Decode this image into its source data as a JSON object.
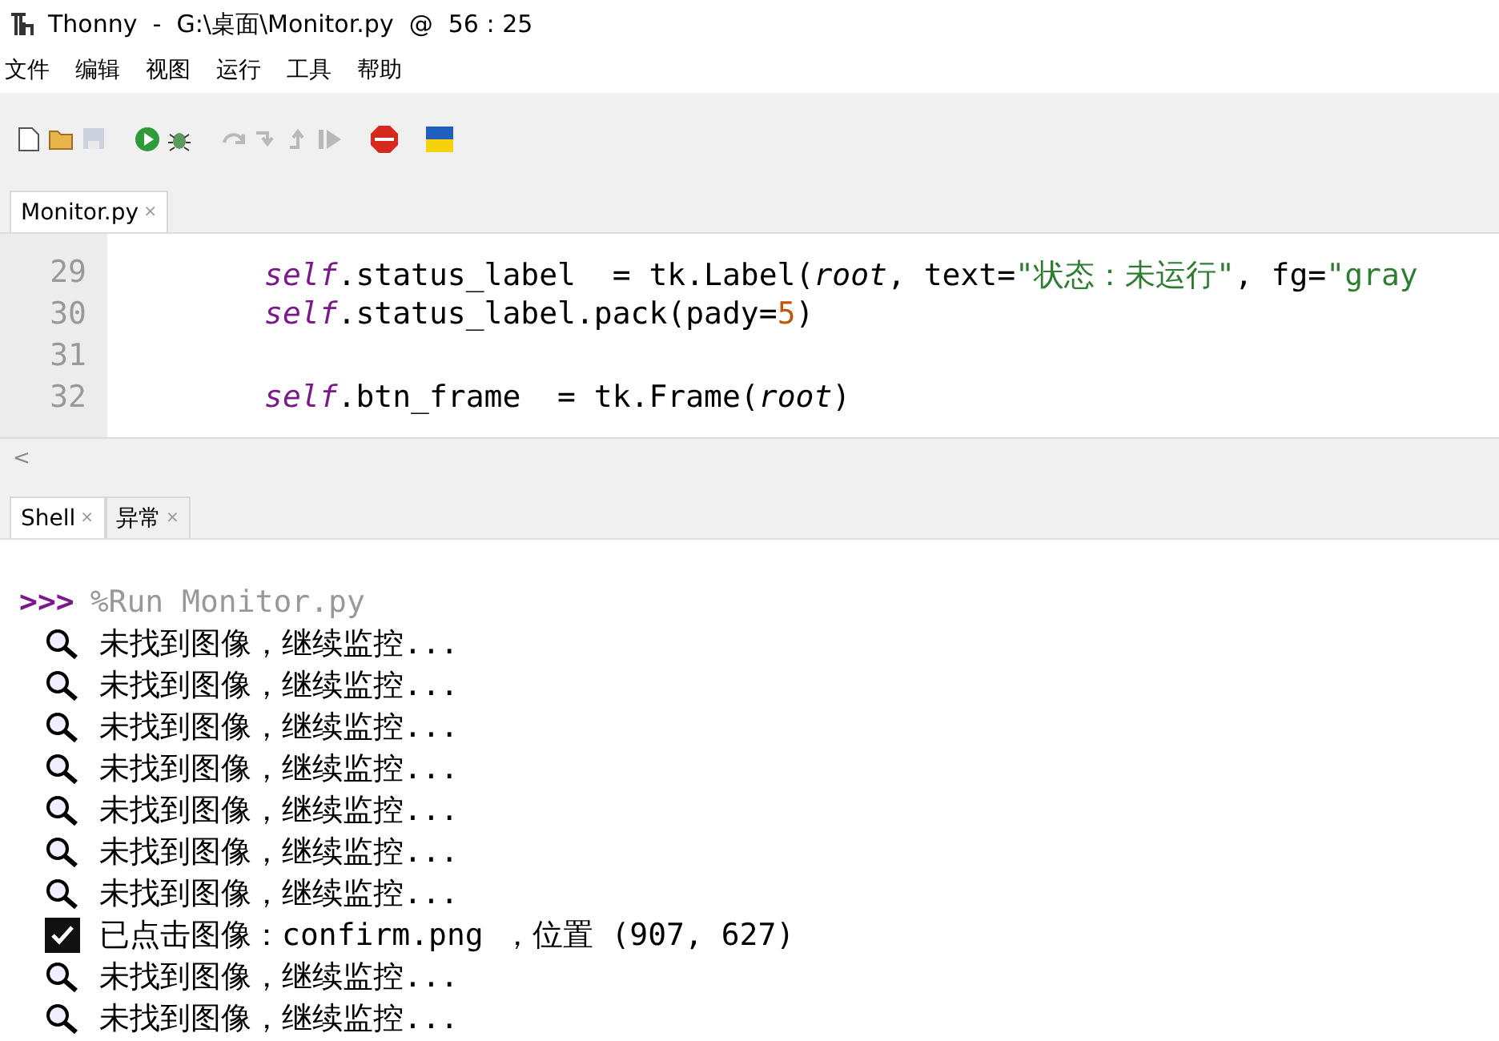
{
  "window": {
    "title": "Thonny  -  G:\\桌面\\Monitor.py  @  56 : 25"
  },
  "menu": [
    "文件",
    "编辑",
    "视图",
    "运行",
    "工具",
    "帮助"
  ],
  "toolbar": [
    {
      "kind": "new",
      "disabled": false
    },
    {
      "kind": "open",
      "disabled": false
    },
    {
      "kind": "save",
      "disabled": true
    },
    {
      "kind": "gap"
    },
    {
      "kind": "run",
      "disabled": false
    },
    {
      "kind": "debug",
      "disabled": false
    },
    {
      "kind": "gap"
    },
    {
      "kind": "step-over",
      "disabled": true
    },
    {
      "kind": "step-into",
      "disabled": true
    },
    {
      "kind": "step-out",
      "disabled": true
    },
    {
      "kind": "resume",
      "disabled": true
    },
    {
      "kind": "gap"
    },
    {
      "kind": "stop",
      "disabled": false
    },
    {
      "kind": "gap"
    },
    {
      "kind": "flag",
      "disabled": false
    }
  ],
  "editor_tabs": [
    {
      "label": "Monitor.py",
      "close": "×",
      "selected": true
    }
  ],
  "editor": {
    "lines": [
      {
        "number": "29",
        "tokens": [
          {
            "kind": "self",
            "text": "self"
          },
          {
            "kind": "plain",
            "text": ".status_label  = tk.Label("
          },
          {
            "kind": "param",
            "text": "root"
          },
          {
            "kind": "plain",
            "text": ", text="
          },
          {
            "kind": "string",
            "text": "\"状态：未运行\""
          },
          {
            "kind": "plain",
            "text": ", fg="
          },
          {
            "kind": "string",
            "text": "\"gray"
          }
        ]
      },
      {
        "number": "30",
        "tokens": [
          {
            "kind": "self",
            "text": "self"
          },
          {
            "kind": "plain",
            "text": ".status_label.pack(pady="
          },
          {
            "kind": "number",
            "text": "5"
          },
          {
            "kind": "plain",
            "text": ")"
          }
        ]
      },
      {
        "number": "31"
      },
      {
        "number": "32",
        "tokens": [
          {
            "kind": "self",
            "text": "self"
          },
          {
            "kind": "plain",
            "text": ".btn_frame  = tk.Frame("
          },
          {
            "kind": "param",
            "text": "root"
          },
          {
            "kind": "plain",
            "text": ")"
          }
        ]
      }
    ],
    "hscroll_arrow": "<"
  },
  "shell_tabs": [
    {
      "label": "Shell",
      "close": "×",
      "selected": true
    },
    {
      "label": "异常",
      "close": "×",
      "selected": false
    }
  ],
  "shell": {
    "prompt": ">>>",
    "command": "%Run Monitor.py",
    "output": [
      {
        "kind": "search",
        "text": "未找到图像，继续监控..."
      },
      {
        "kind": "search",
        "text": "未找到图像，继续监控..."
      },
      {
        "kind": "search",
        "text": "未找到图像，继续监控..."
      },
      {
        "kind": "search",
        "text": "未找到图像，继续监控..."
      },
      {
        "kind": "search",
        "text": "未找到图像，继续监控..."
      },
      {
        "kind": "search",
        "text": "未找到图像，继续监控..."
      },
      {
        "kind": "search",
        "text": "未找到图像，继续监控..."
      },
      {
        "kind": "check",
        "text": "已点击图像：confirm.png ，位置 (907, 627)"
      },
      {
        "kind": "search",
        "text": "未找到图像，继续监控..."
      },
      {
        "kind": "search",
        "text": "未找到图像，继续监控..."
      }
    ]
  }
}
